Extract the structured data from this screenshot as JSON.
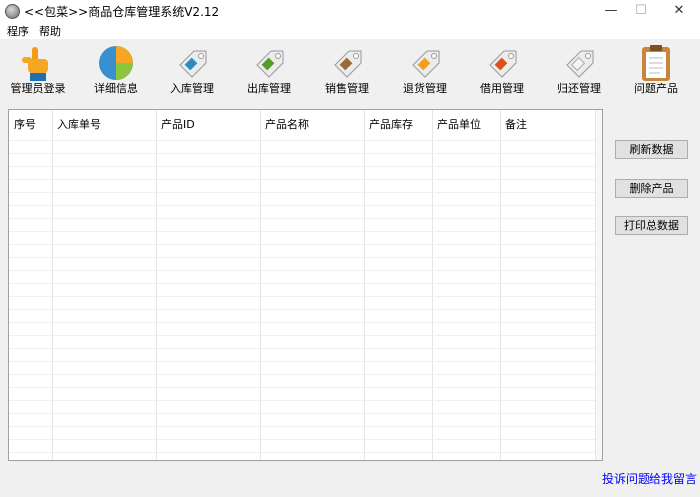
{
  "window": {
    "title": "<<包菜>>商品仓库管理系统V2.12",
    "minimize": "—",
    "maximize": "☐",
    "close": "✕"
  },
  "menu": [
    "程序",
    "帮助"
  ],
  "toolbar": [
    {
      "label": "管理员登录",
      "icon": "pointing-hand-icon",
      "color": "#f39c12"
    },
    {
      "label": "详细信息",
      "icon": "pie-chart-icon",
      "color": "#3a8fd0"
    },
    {
      "label": "入库管理",
      "icon": "tag-icon",
      "color": "#2a8fc0"
    },
    {
      "label": "出库管理",
      "icon": "tag-icon",
      "color": "#5a9a2a"
    },
    {
      "label": "销售管理",
      "icon": "tag-icon",
      "color": "#9a6a3a"
    },
    {
      "label": "退货管理",
      "icon": "tag-icon",
      "color": "#f0a020"
    },
    {
      "label": "借用管理",
      "icon": "tag-icon",
      "color": "#e0501a"
    },
    {
      "label": "归还管理",
      "icon": "tag-icon",
      "color": "#c8c8c8"
    },
    {
      "label": "问题产品",
      "icon": "clipboard-icon",
      "color": "#c8863a"
    }
  ],
  "table": {
    "columns": [
      "序号",
      "入库单号",
      "产品ID",
      "产品名称",
      "产品库存",
      "产品单位",
      "备注"
    ],
    "rows": []
  },
  "actions": {
    "refresh": "刷新数据",
    "delete": "删除产品",
    "print": "打印总数据"
  },
  "footer": {
    "complain": "投诉问题",
    "message": "给我留言"
  }
}
